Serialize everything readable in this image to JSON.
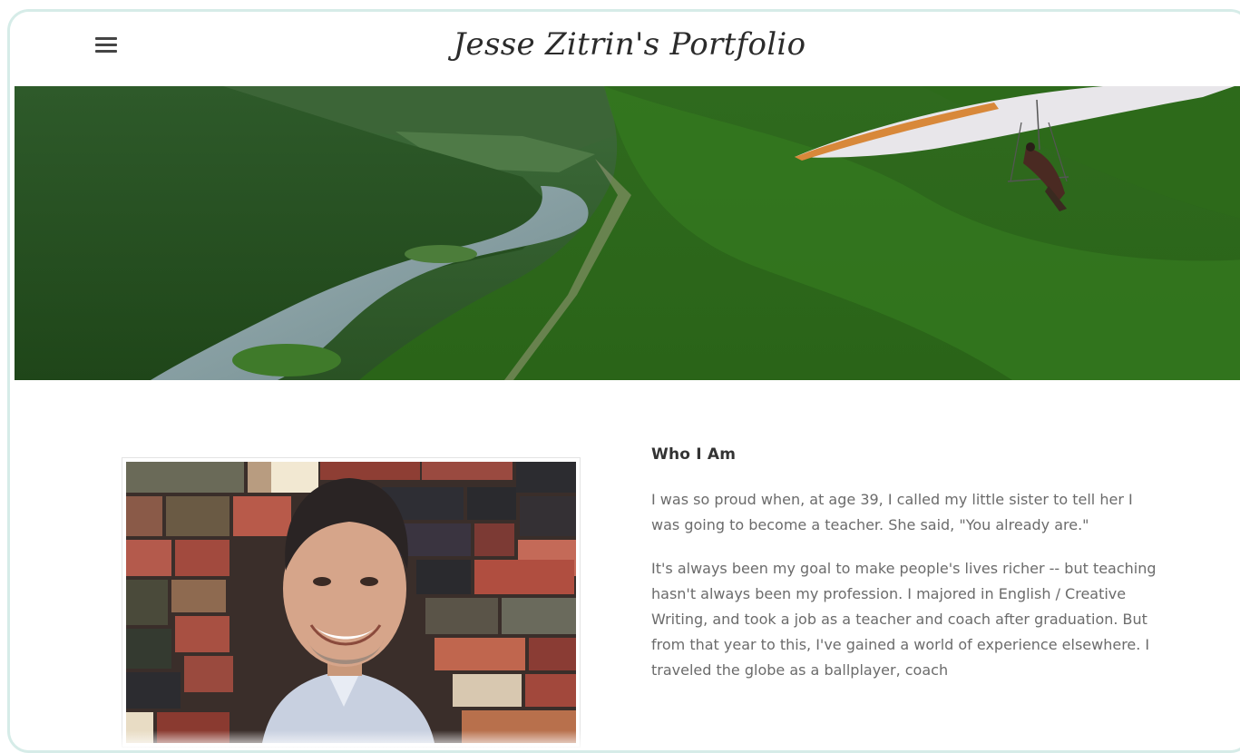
{
  "header": {
    "title": "Jesse Zitrin's Portfolio",
    "menu_icon": "hamburger-menu-icon"
  },
  "hero": {
    "scene": "hero-landscape-image"
  },
  "about": {
    "heading": "Who I Am",
    "paragraphs": [
      "I was so proud when, at age 39, I called my little sister to tell her I was going to become a teacher. She said, \"You already are.\"",
      "It's always been my goal to make people's lives richer -- but teaching hasn't always been my profession. I majored in English / Creative Writing, and took a job as a teacher and coach after graduation. But from that year to this, I've gained a world of experience elsewhere. I traveled the globe as a ballplayer, coach"
    ]
  },
  "colors": {
    "frame_border": "#d6ece8",
    "title_text": "#2b2b2b",
    "body_text": "#6b6b6b"
  }
}
